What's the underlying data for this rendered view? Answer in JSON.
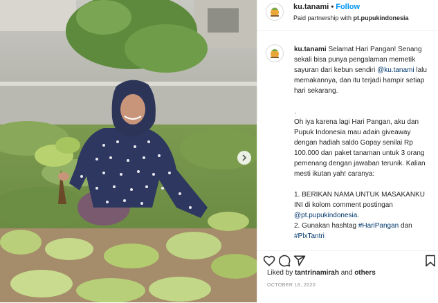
{
  "header": {
    "username": "ku.tanami",
    "separator": "•",
    "follow_label": "Follow",
    "partnership_prefix": "Paid partnership with ",
    "partner_name": "pt.pupukindonesia"
  },
  "caption": {
    "username": "ku.tanami",
    "line1_text": " Selamat Hari Pangan! Senang sekali bisa punya pengalaman memetik sayuran dari kebun sendiri ",
    "mention1": "@ku.tanami",
    "line1_tail": " lalu memakannya, dan itu terjadi hampir setiap hari sekarang.",
    "dot_line": ".",
    "para2": "Oh iya karena lagi Hari Pangan, aku dan Pupuk Indonesia mau adain giveaway dengan hadiah saldo Gopay senilai Rp 100.000 dan paket tanaman untuk 3 orang pemenang dengan jawaban terunik. Kalian mesti ikutan yah! caranya:",
    "step1": "1. BERIKAN NAMA UNTUK MASAKANKU INI di kolom comment postingan ",
    "mention2": "@pt.pupukindonesia",
    "step1_tail": ".",
    "step2": "2. Gunakan hashtag ",
    "hashtag1": "#HariPangan",
    "and": " dan ",
    "hashtag2": "#PlxTantri"
  },
  "footer": {
    "liked_prefix": "Liked by ",
    "liked_user": "tantrinamirah",
    "liked_suffix": " and ",
    "liked_others": "others",
    "date": "OCTOBER 16, 2020"
  },
  "icons": [
    "like-heart-icon",
    "comment-icon",
    "share-icon",
    "bookmark-icon",
    "next-arrow-icon"
  ],
  "colors": {
    "follow": "#0095f6",
    "link": "#00376b",
    "muted": "#8e8e8e",
    "text": "#262626"
  }
}
